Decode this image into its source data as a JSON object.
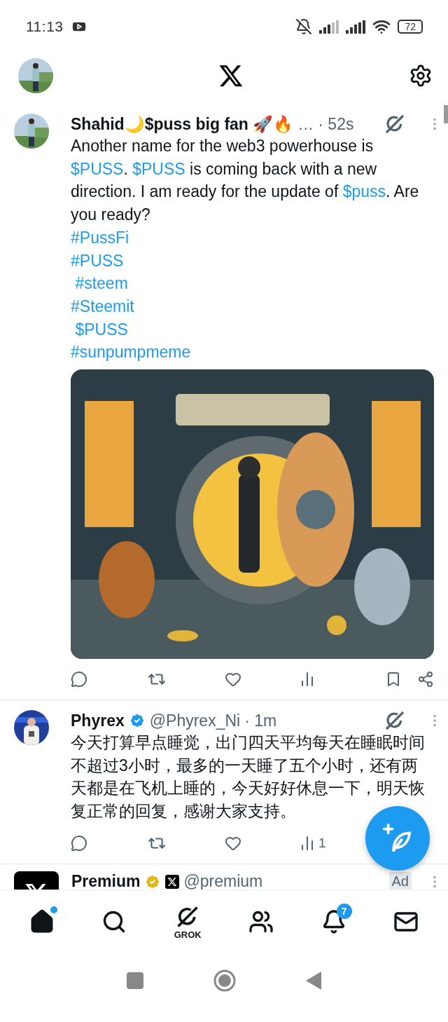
{
  "status_bar": {
    "time": "11:13",
    "battery": "72"
  },
  "tweets": [
    {
      "name": "Shahid🌙$puss big fan 🚀🔥",
      "ellipsis": "…",
      "time": "· 52s",
      "verified": false,
      "body": [
        {
          "kind": "text",
          "text": "Another name for the web3 powerhouse is "
        },
        {
          "kind": "link",
          "text": "$PUSS"
        },
        {
          "kind": "text",
          "text": ". "
        },
        {
          "kind": "link",
          "text": "$PUSS"
        },
        {
          "kind": "text",
          "text": " is coming back with a new direction. I am ready for the update of "
        },
        {
          "kind": "link",
          "text": "$puss"
        },
        {
          "kind": "text",
          "text": ". Are you ready?"
        }
      ],
      "tags": [
        "#PussFi",
        "#PUSS",
        " #steem",
        "#Steemit",
        " $PUSS",
        "#sunpumpmeme"
      ],
      "media": {
        "kind": "picture"
      },
      "actions": [
        {
          "kind": "reply"
        },
        {
          "kind": "repost"
        },
        {
          "kind": "like"
        },
        {
          "kind": "views"
        },
        {
          "kind": "bookmark"
        },
        {
          "kind": "share"
        }
      ]
    },
    {
      "name": "Phyrex",
      "handle": "@Phyrex_Ni",
      "time": "· 1m",
      "verified": true,
      "body": [
        {
          "kind": "text",
          "text": "今天打算早点睡觉，出门四天平均每天在睡眠时间不超过3小时，最多的一天睡了五个小时，还有两天都是在飞机上睡的，今天好好休息一下，明天恢复正常的回复，感谢大家支持。"
        }
      ],
      "actions": [
        {
          "kind": "reply"
        },
        {
          "kind": "repost"
        },
        {
          "kind": "like"
        },
        {
          "kind": "views",
          "count": "1"
        }
      ]
    }
  ],
  "ad": {
    "name": "Premium",
    "handle": "@premium",
    "tag": "Ad"
  },
  "nav": [
    {
      "kind": "home",
      "selected": true,
      "dot": true
    },
    {
      "kind": "search",
      "selected": false
    },
    {
      "kind": "grok",
      "label": "GROK",
      "selected": false
    },
    {
      "kind": "communities",
      "selected": false
    },
    {
      "kind": "notifications",
      "badge": "7",
      "selected": false
    },
    {
      "kind": "messages",
      "selected": false
    }
  ]
}
